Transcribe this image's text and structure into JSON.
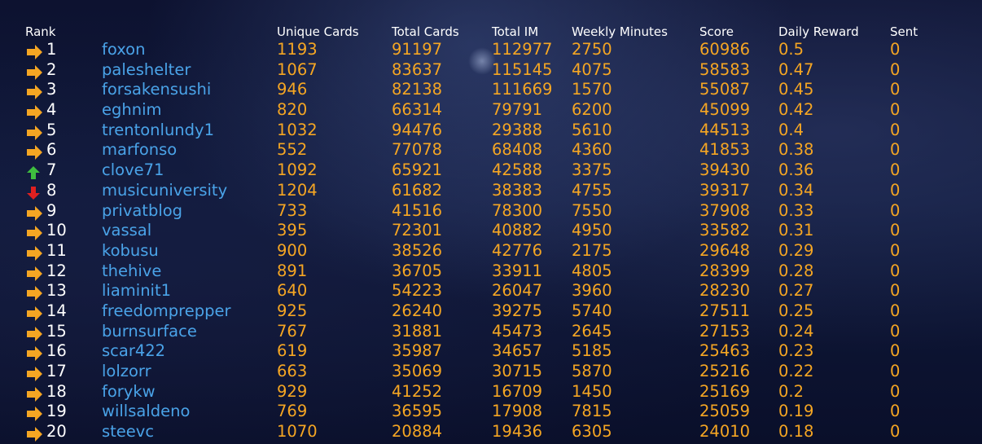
{
  "colors": {
    "header": "#ffffff",
    "rank": "#ffffff",
    "name": "#4aa3e8",
    "value": "#f5a623",
    "trend_same": "#f5a623",
    "trend_up": "#3fbf3f",
    "trend_down": "#e02020"
  },
  "headers": {
    "rank": "Rank",
    "unique": "Unique Cards",
    "total": "Total Cards",
    "im": "Total IM",
    "weekly": "Weekly Minutes",
    "score": "Score",
    "daily": "Daily Reward",
    "sent": "Sent"
  },
  "rows": [
    {
      "trend": "same",
      "rank": "1",
      "name": "foxon",
      "unique": "1193",
      "total": "91197",
      "im": "112977",
      "weekly": "2750",
      "score": "60986",
      "daily": "0.5",
      "sent": "0"
    },
    {
      "trend": "same",
      "rank": "2",
      "name": "paleshelter",
      "unique": "1067",
      "total": "83637",
      "im": "115145",
      "weekly": "4075",
      "score": "58583",
      "daily": "0.47",
      "sent": "0"
    },
    {
      "trend": "same",
      "rank": "3",
      "name": "forsakensushi",
      "unique": "946",
      "total": "82138",
      "im": "111669",
      "weekly": "1570",
      "score": "55087",
      "daily": "0.45",
      "sent": "0"
    },
    {
      "trend": "same",
      "rank": "4",
      "name": "eghnim",
      "unique": "820",
      "total": "66314",
      "im": "79791",
      "weekly": "6200",
      "score": "45099",
      "daily": "0.42",
      "sent": "0"
    },
    {
      "trend": "same",
      "rank": "5",
      "name": "trentonlundy1",
      "unique": "1032",
      "total": "94476",
      "im": "29388",
      "weekly": "5610",
      "score": "44513",
      "daily": "0.4",
      "sent": "0"
    },
    {
      "trend": "same",
      "rank": "6",
      "name": "marfonso",
      "unique": "552",
      "total": "77078",
      "im": "68408",
      "weekly": "4360",
      "score": "41853",
      "daily": "0.38",
      "sent": "0"
    },
    {
      "trend": "up",
      "rank": "7",
      "name": "clove71",
      "unique": "1092",
      "total": "65921",
      "im": "42588",
      "weekly": "3375",
      "score": "39430",
      "daily": "0.36",
      "sent": "0"
    },
    {
      "trend": "down",
      "rank": "8",
      "name": "musicuniversity",
      "unique": "1204",
      "total": "61682",
      "im": "38383",
      "weekly": "4755",
      "score": "39317",
      "daily": "0.34",
      "sent": "0"
    },
    {
      "trend": "same",
      "rank": "9",
      "name": "privatblog",
      "unique": "733",
      "total": "41516",
      "im": "78300",
      "weekly": "7550",
      "score": "37908",
      "daily": "0.33",
      "sent": "0"
    },
    {
      "trend": "same",
      "rank": "10",
      "name": "vassal",
      "unique": "395",
      "total": "72301",
      "im": "40882",
      "weekly": "4950",
      "score": "33582",
      "daily": "0.31",
      "sent": "0"
    },
    {
      "trend": "same",
      "rank": "11",
      "name": "kobusu",
      "unique": "900",
      "total": "38526",
      "im": "42776",
      "weekly": "2175",
      "score": "29648",
      "daily": "0.29",
      "sent": "0"
    },
    {
      "trend": "same",
      "rank": "12",
      "name": "thehive",
      "unique": "891",
      "total": "36705",
      "im": "33911",
      "weekly": "4805",
      "score": "28399",
      "daily": "0.28",
      "sent": "0"
    },
    {
      "trend": "same",
      "rank": "13",
      "name": "liaminit1",
      "unique": "640",
      "total": "54223",
      "im": "26047",
      "weekly": "3960",
      "score": "28230",
      "daily": "0.27",
      "sent": "0"
    },
    {
      "trend": "same",
      "rank": "14",
      "name": "freedomprepper",
      "unique": "925",
      "total": "26240",
      "im": "39275",
      "weekly": "5740",
      "score": "27511",
      "daily": "0.25",
      "sent": "0"
    },
    {
      "trend": "same",
      "rank": "15",
      "name": "burnsurface",
      "unique": "767",
      "total": "31881",
      "im": "45473",
      "weekly": "2645",
      "score": "27153",
      "daily": "0.24",
      "sent": "0"
    },
    {
      "trend": "same",
      "rank": "16",
      "name": "scar422",
      "unique": "619",
      "total": "35987",
      "im": "34657",
      "weekly": "5185",
      "score": "25463",
      "daily": "0.23",
      "sent": "0"
    },
    {
      "trend": "same",
      "rank": "17",
      "name": "lolzorr",
      "unique": "663",
      "total": "35069",
      "im": "30715",
      "weekly": "5870",
      "score": "25216",
      "daily": "0.22",
      "sent": "0"
    },
    {
      "trend": "same",
      "rank": "18",
      "name": "forykw",
      "unique": "929",
      "total": "41252",
      "im": "16709",
      "weekly": "1450",
      "score": "25169",
      "daily": "0.2",
      "sent": "0"
    },
    {
      "trend": "same",
      "rank": "19",
      "name": "willsaldeno",
      "unique": "769",
      "total": "36595",
      "im": "17908",
      "weekly": "7815",
      "score": "25059",
      "daily": "0.19",
      "sent": "0"
    },
    {
      "trend": "same",
      "rank": "20",
      "name": "steevc",
      "unique": "1070",
      "total": "20884",
      "im": "19436",
      "weekly": "6305",
      "score": "24010",
      "daily": "0.18",
      "sent": "0"
    }
  ]
}
